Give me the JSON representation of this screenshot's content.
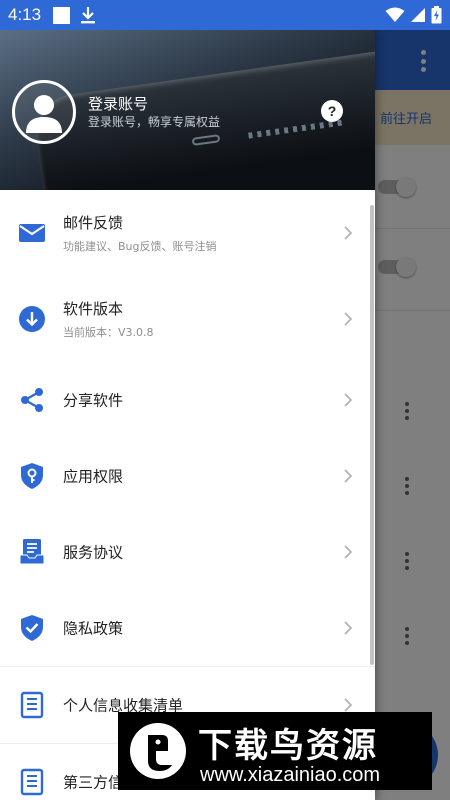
{
  "status_bar": {
    "time": "4:13",
    "icons": [
      "notification-square-icon",
      "download-icon",
      "wifi-icon",
      "signal-icon",
      "battery-icon"
    ]
  },
  "background_app": {
    "banner_action": "前往开启"
  },
  "drawer": {
    "header": {
      "title": "登录账号",
      "subtitle": "登录账号，畅享专属权益",
      "help_label": "?"
    },
    "items": [
      {
        "label": "邮件反馈",
        "sub": "功能建议、Bug反馈、账号注销",
        "icon": "mail-icon"
      },
      {
        "label": "软件版本",
        "sub": "当前版本：V3.0.8",
        "icon": "download-circle-icon"
      },
      {
        "label": "分享软件",
        "icon": "share-icon"
      },
      {
        "label": "应用权限",
        "icon": "key-shield-icon"
      },
      {
        "label": "服务协议",
        "icon": "document-icon"
      },
      {
        "label": "隐私政策",
        "icon": "shield-check-icon"
      },
      {
        "label": "个人信息收集清单",
        "icon": "list-icon"
      },
      {
        "label": "第三方信息共享清单",
        "icon": "list-icon"
      }
    ]
  },
  "watermark": {
    "title": "下载鸟资源",
    "url": "www.xiazainiao.com"
  },
  "colors": {
    "primary": "#2f69d6",
    "icon_blue": "#2f69d6",
    "text": "#222222",
    "subtext": "#8f8f8f"
  }
}
